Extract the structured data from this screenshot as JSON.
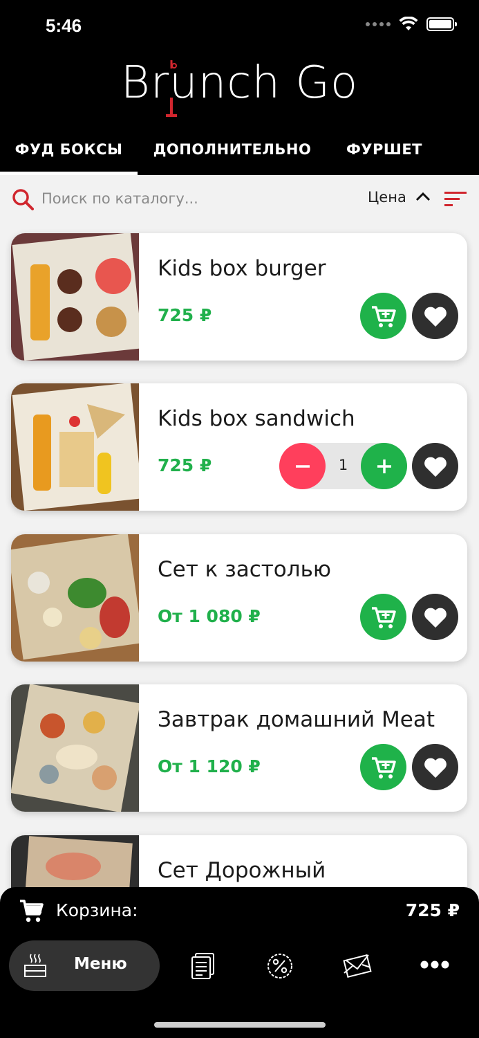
{
  "status_bar": {
    "time": "5:46"
  },
  "brand": {
    "logo_text": "Brunch Go",
    "accent_color": "#d0262e"
  },
  "tabs": [
    {
      "label": "ФУД БОКСЫ",
      "active": true
    },
    {
      "label": "ДОПОЛНИТЕЛЬНО",
      "active": false
    },
    {
      "label": "ФУРШЕТ",
      "active": false
    }
  ],
  "search": {
    "placeholder": "Поиск по каталогу...",
    "value": ""
  },
  "sort": {
    "label": "Цена",
    "direction": "ascending"
  },
  "products": [
    {
      "title": "Kids box burger",
      "price": "725 ₽",
      "in_cart": false
    },
    {
      "title": "Kids box sandwich",
      "price": "725 ₽",
      "in_cart": true,
      "quantity": "1"
    },
    {
      "title": "Сет к застолью",
      "price": "От 1 080 ₽",
      "in_cart": false
    },
    {
      "title": "Завтрак домашний Meat",
      "price": "От 1 120 ₽",
      "in_cart": false
    },
    {
      "title": "Сет Дорожный",
      "price": "",
      "in_cart": false
    }
  ],
  "cart": {
    "label": "Корзина:",
    "total": "725 ₽"
  },
  "bottom_nav": {
    "menu_label": "Меню",
    "items": [
      "menu-icon",
      "receipt-icon",
      "discount-icon",
      "mail-icon",
      "more-icon"
    ]
  },
  "colors": {
    "header_bg": "#000000",
    "price_green": "#20b04b",
    "cart_green": "#1fb24a",
    "minus_red": "#ff3f5c",
    "fav_dark": "#2f2f2f"
  }
}
